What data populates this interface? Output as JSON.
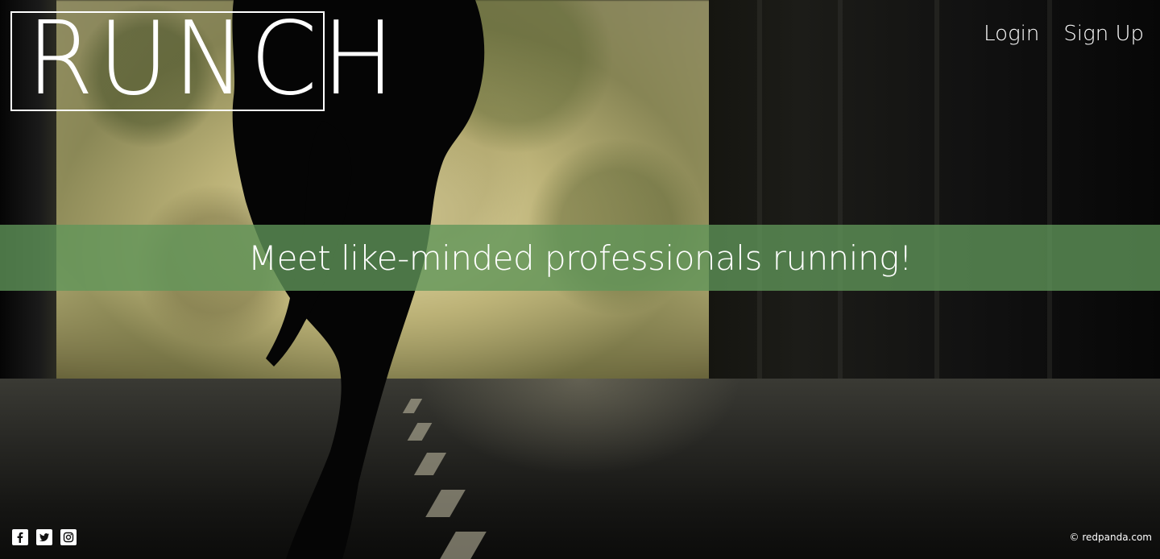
{
  "brand": {
    "logo_text": "RUNCH"
  },
  "nav": {
    "login_label": "Login",
    "signup_label": "Sign Up"
  },
  "hero": {
    "tagline": "Meet like-minded professionals running!"
  },
  "social": {
    "icons": [
      "facebook-icon",
      "twitter-icon",
      "instagram-icon"
    ]
  },
  "footer": {
    "copyright": "© redpanda.com"
  },
  "colors": {
    "band": "#60965A",
    "text": "#FFFFFF"
  }
}
